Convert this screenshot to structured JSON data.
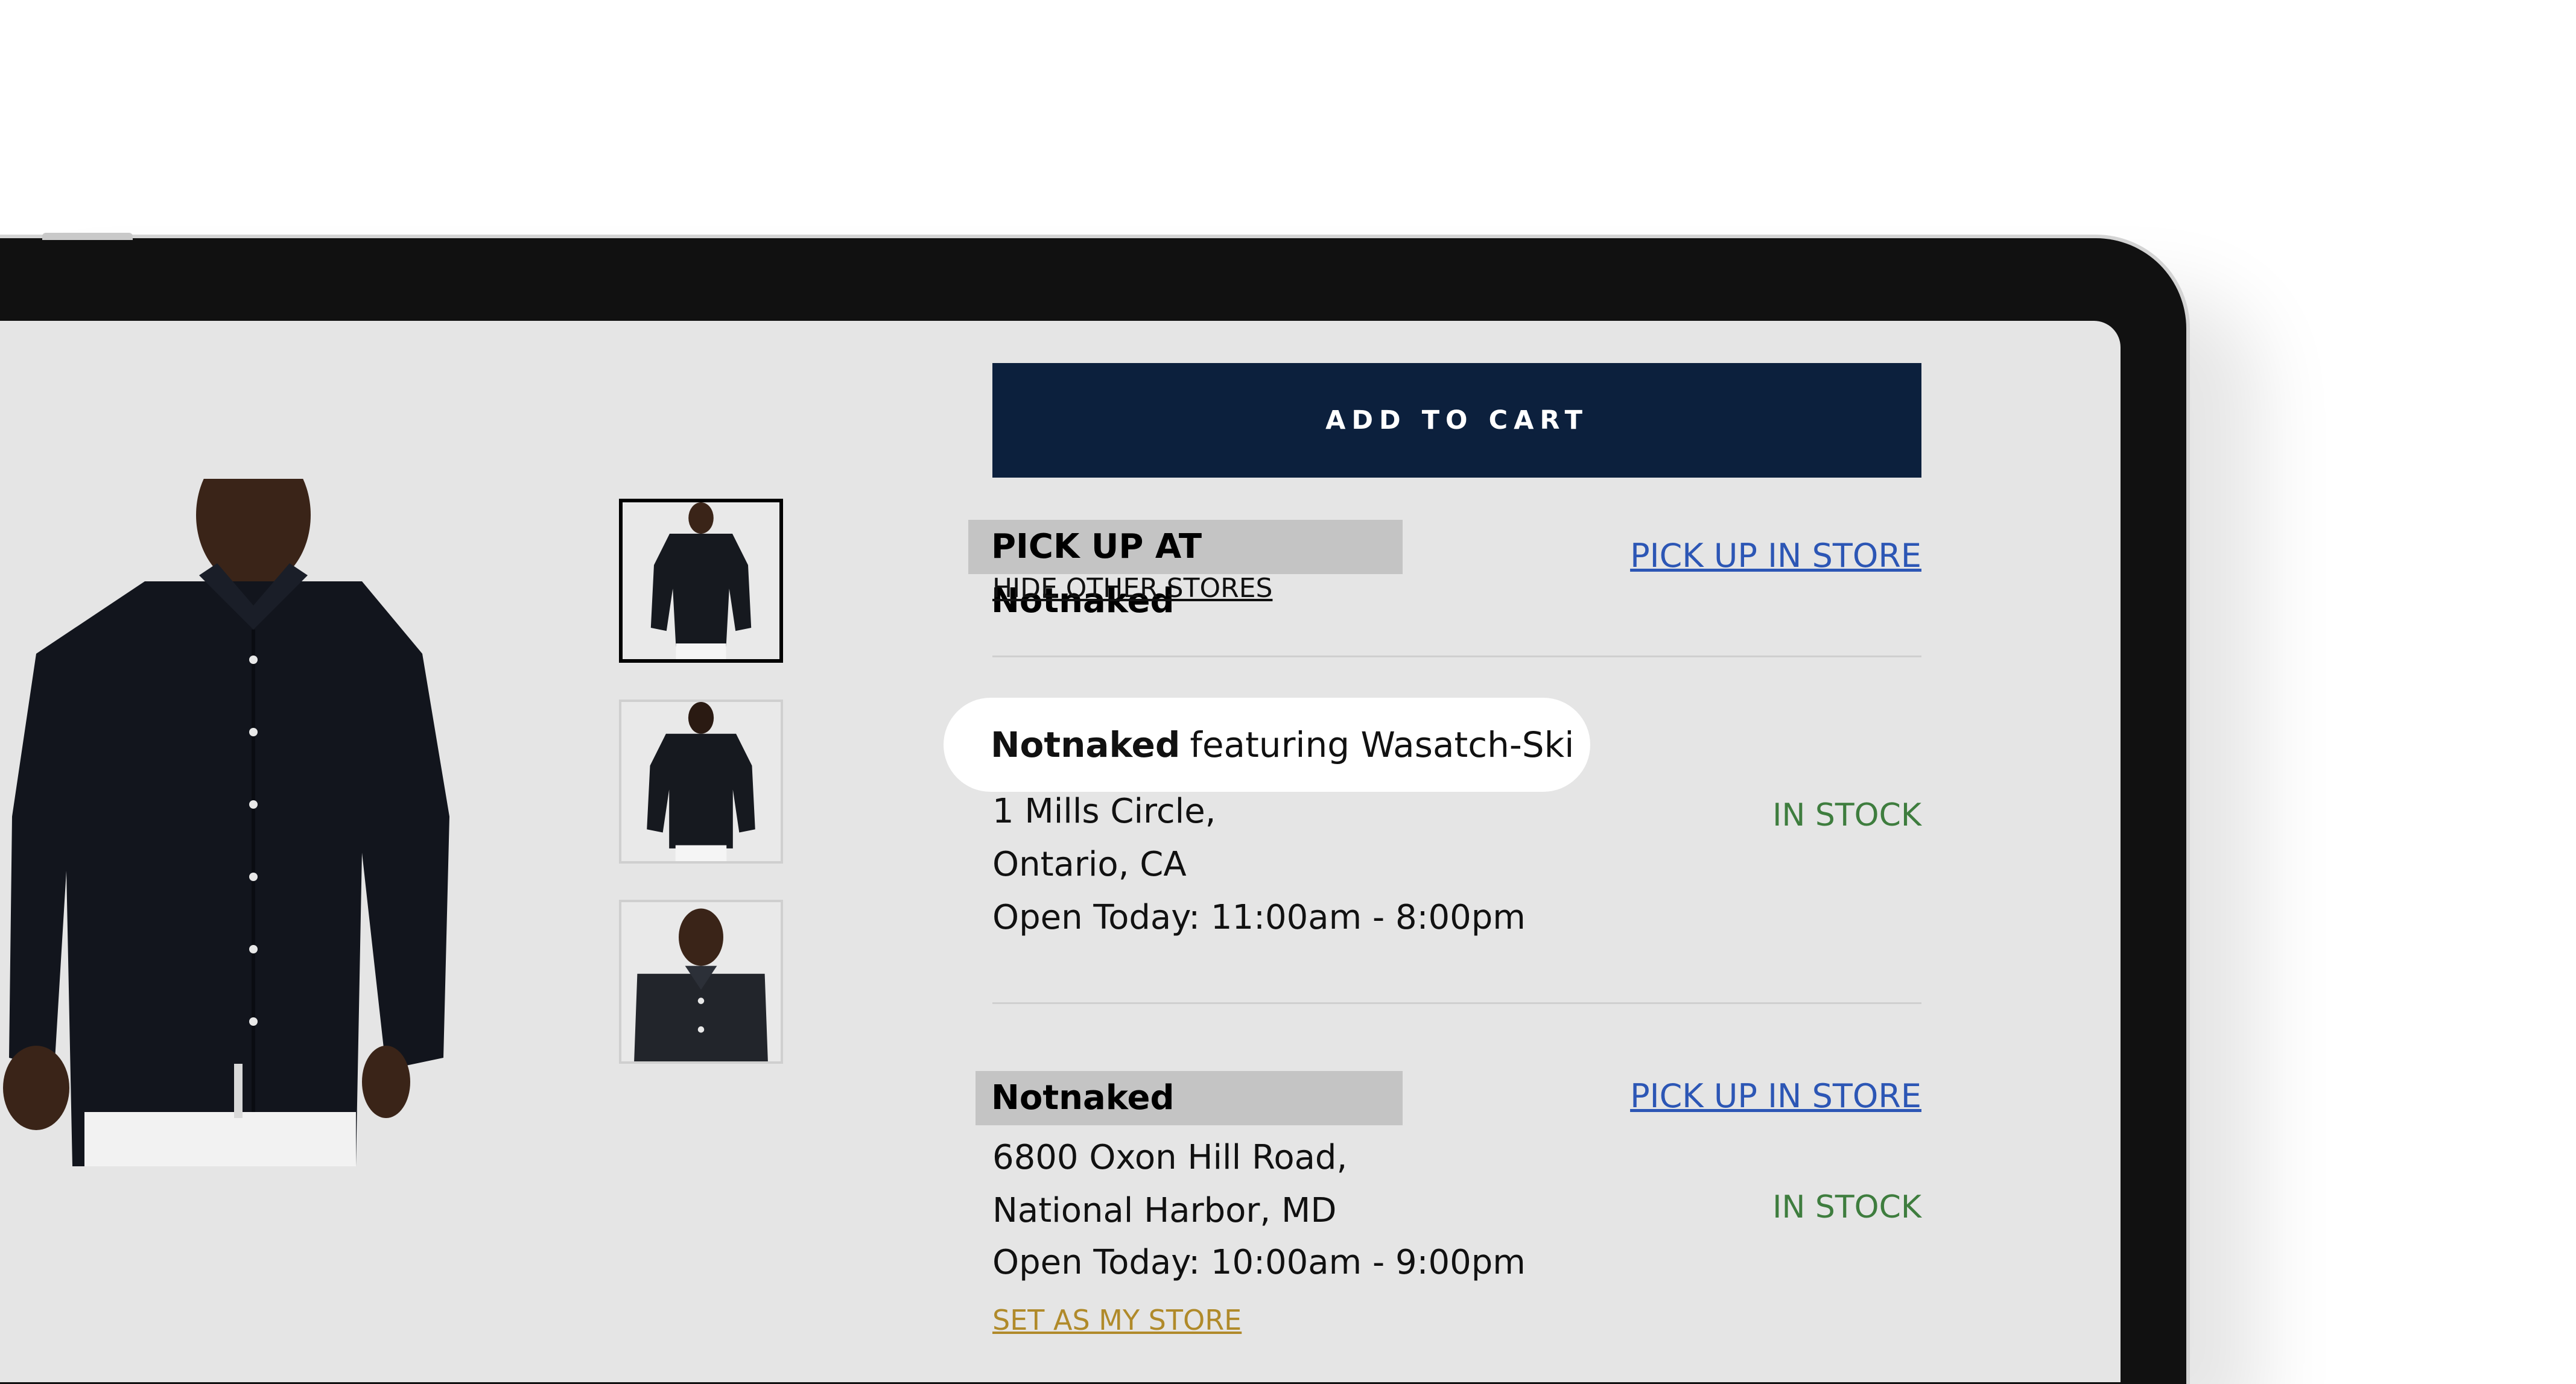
{
  "product": {
    "main_image_alt": "Model wearing black long-sleeve button-down shirt",
    "thumbnails": [
      {
        "alt": "Front view",
        "selected": true
      },
      {
        "alt": "Back view",
        "selected": false
      },
      {
        "alt": "Collar detail",
        "selected": false
      }
    ]
  },
  "cart": {
    "add_label": "ADD TO CART"
  },
  "pickup": {
    "header": "PICK UP AT Notnaked",
    "hide_link": "HIDE OTHER STORES",
    "pickup_link": "PICK UP IN STORE"
  },
  "stores": [
    {
      "name": "Notnaked",
      "featuring": "featuring Wasatch-Ski",
      "address_line1": "1 Mills Circle,",
      "address_line2": "Ontario, CA",
      "hours": "Open Today: 11:00am - 8:00pm",
      "status": "IN STOCK"
    },
    {
      "name": "Notnaked",
      "address_line1": "6800 Oxon Hill Road,",
      "address_line2": "National Harbor, MD",
      "hours": "Open Today: 10:00am - 9:00pm",
      "pickup_link": "PICK UP IN STORE",
      "status": "IN STOCK",
      "set_store": "SET AS MY STORE"
    }
  ],
  "colors": {
    "cart_button": "#0c203d",
    "link_blue": "#2c56b5",
    "in_stock_green": "#3e7d3e",
    "set_store_gold": "#b08a2a",
    "screen_bg": "#e5e5e5"
  }
}
